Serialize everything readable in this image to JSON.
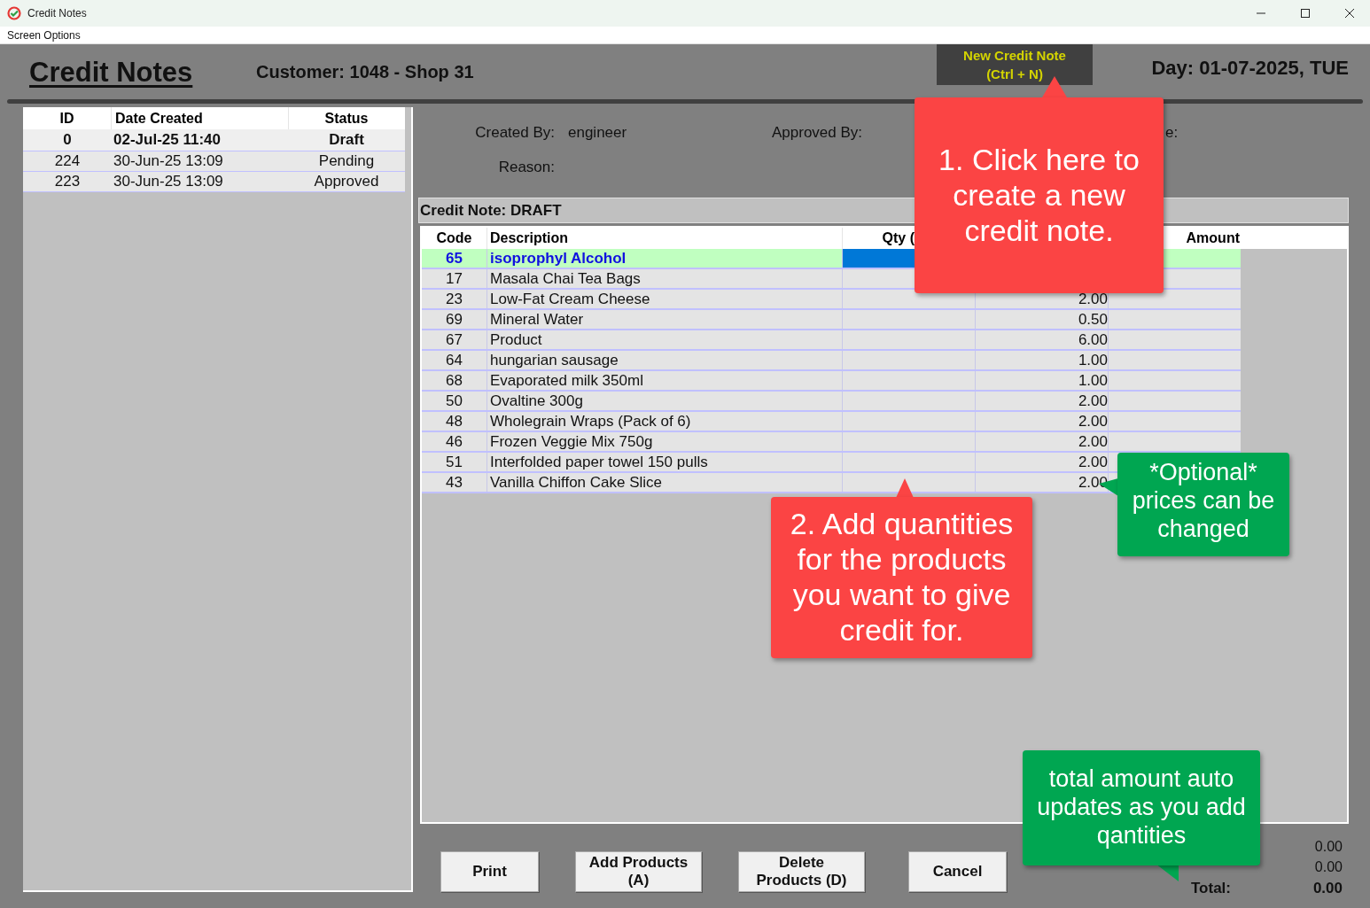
{
  "window": {
    "title": "Credit Notes"
  },
  "menu": [
    "Screen Options"
  ],
  "header": {
    "title": "Credit Notes",
    "customer": "Customer: 1048 - Shop 31",
    "new_button": "New Credit Note\n(Ctrl + N)",
    "day": "Day: 01-07-2025, TUE"
  },
  "notes_list": {
    "columns": [
      "ID",
      "Date Created",
      "Status"
    ],
    "rows": [
      {
        "id": "0",
        "date": "02-Jul-25 11:40",
        "status": "Draft",
        "selected": true
      },
      {
        "id": "224",
        "date": "30-Jun-25 13:09",
        "status": "Pending",
        "selected": false
      },
      {
        "id": "223",
        "date": "30-Jun-25 13:09",
        "status": "Approved",
        "selected": false
      }
    ]
  },
  "details": {
    "created_by_label": "Created By:",
    "created_by": "engineer",
    "approved_by_label": "Approved By:",
    "label_3": "e:",
    "reason_label": "Reason:"
  },
  "credit_note": {
    "title": "Credit Note: DRAFT",
    "columns": {
      "code": "Code",
      "description": "Description",
      "qty": "Qty (",
      "amount": "Amount"
    },
    "rows": [
      {
        "code": "65",
        "description": "isoprophyl Alcohol",
        "selected": true
      },
      {
        "code": "17",
        "description": "Masala Chai Tea Bags",
        "selected": false
      },
      {
        "code": "23",
        "description": "Low-Fat Cream Cheese",
        "column_4": "2.00",
        "selected": false
      },
      {
        "code": "69",
        "description": "Mineral Water",
        "column_4": "0.50",
        "selected": false
      },
      {
        "code": "67",
        "description": "Product",
        "column_4": "6.00",
        "selected": false
      },
      {
        "code": "64",
        "description": "hungarian sausage",
        "column_4": "1.00",
        "selected": false
      },
      {
        "code": "68",
        "description": "Evaporated milk 350ml",
        "column_4": "1.00",
        "selected": false
      },
      {
        "code": "50",
        "description": "Ovaltine 300g",
        "column_4": "2.00",
        "selected": false
      },
      {
        "code": "48",
        "description": "Wholegrain Wraps (Pack of 6)",
        "column_4": "2.00",
        "selected": false
      },
      {
        "code": "46",
        "description": "Frozen Veggie Mix 750g",
        "column_4": "2.00",
        "selected": false
      },
      {
        "code": "51",
        "description": "Interfolded paper towel 150 pulls",
        "column_4": "2.00",
        "selected": false
      },
      {
        "code": "43",
        "description": "Vanilla Chiffon Cake Slice",
        "column_4": "2.00",
        "selected": false
      }
    ]
  },
  "buttons": [
    "Print",
    "Add Products\n(A)",
    "Delete\nProducts (D)",
    "Cancel"
  ],
  "totals": {
    "values": [
      "0.00",
      "0.00"
    ],
    "total_label": "Total:",
    "total": "0.00"
  },
  "callouts": [
    {
      "text": "1. Click here to create a new credit note.",
      "color": "#fb4444"
    },
    {
      "text": "2. Add quantities for the products you want to give credit for.",
      "color": "#fb4444"
    },
    {
      "text": "*Optional* prices can be changed",
      "color": "#00a651"
    },
    {
      "text": "total amount auto updates as you add qantities",
      "color": "#00a651"
    }
  ]
}
